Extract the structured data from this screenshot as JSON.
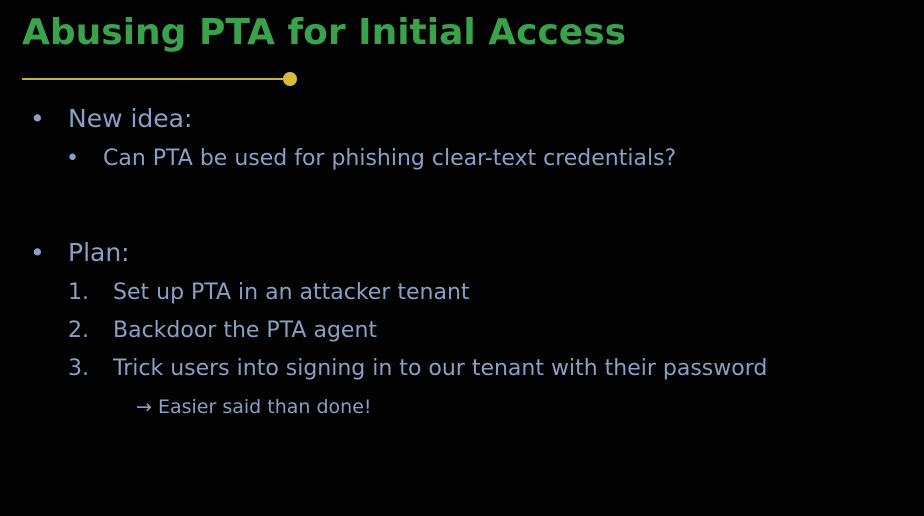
{
  "slide": {
    "title": "Abusing PTA for Initial Access",
    "colors": {
      "background": "#020202",
      "title": "#3aa24a",
      "accent_rule": "#c9b23a",
      "body_text": "#8a9fc4"
    },
    "sections": [
      {
        "bullet": "•",
        "heading": "New idea:",
        "items": [
          {
            "bullet": "•",
            "text": "Can PTA be used for phishing clear-text credentials?"
          }
        ]
      },
      {
        "bullet": "•",
        "heading": "Plan:",
        "steps": [
          {
            "number": "1.",
            "text": "Set up PTA in an attacker tenant"
          },
          {
            "number": "2.",
            "text": "Backdoor the PTA agent"
          },
          {
            "number": "3.",
            "text": "Trick users into signing in to our tenant with their password"
          }
        ],
        "note": "→ Easier said than done!"
      }
    ]
  }
}
